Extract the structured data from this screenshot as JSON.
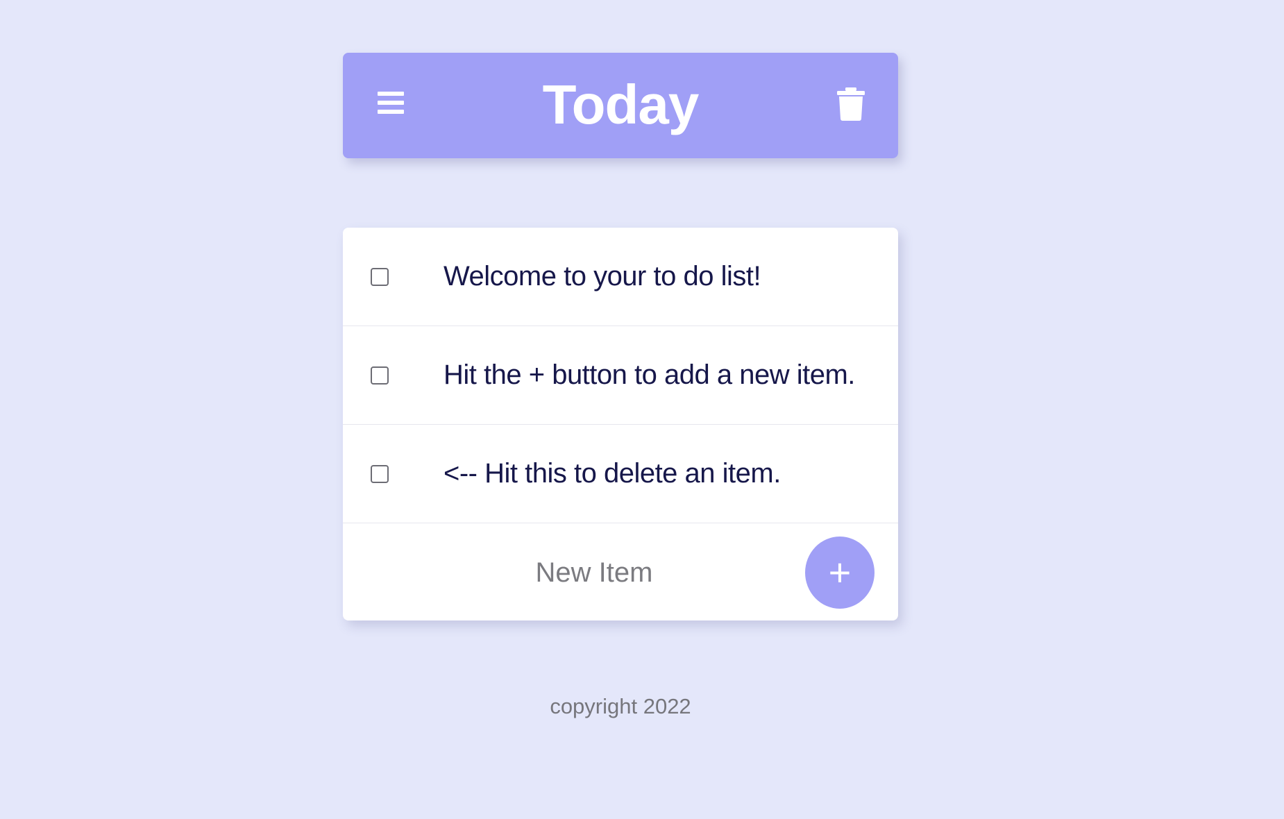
{
  "header": {
    "title": "Today",
    "menu_icon": "hamburger-menu-icon",
    "delete_icon": "trash-icon",
    "background_color": "#a09ff6"
  },
  "items": [
    {
      "label": "Welcome to your to do list!",
      "checked": false
    },
    {
      "label": "Hit the + button to add a new item.",
      "checked": false
    },
    {
      "label": "<-- Hit this to delete an item.",
      "checked": false
    }
  ],
  "new_item": {
    "placeholder": "New Item",
    "value": "",
    "add_label": "+"
  },
  "footer": {
    "text": "copyright 2022"
  },
  "colors": {
    "page_background": "#e4e7fa",
    "accent": "#a09ff6",
    "item_text": "#16174a",
    "footer_text": "#76767c"
  }
}
